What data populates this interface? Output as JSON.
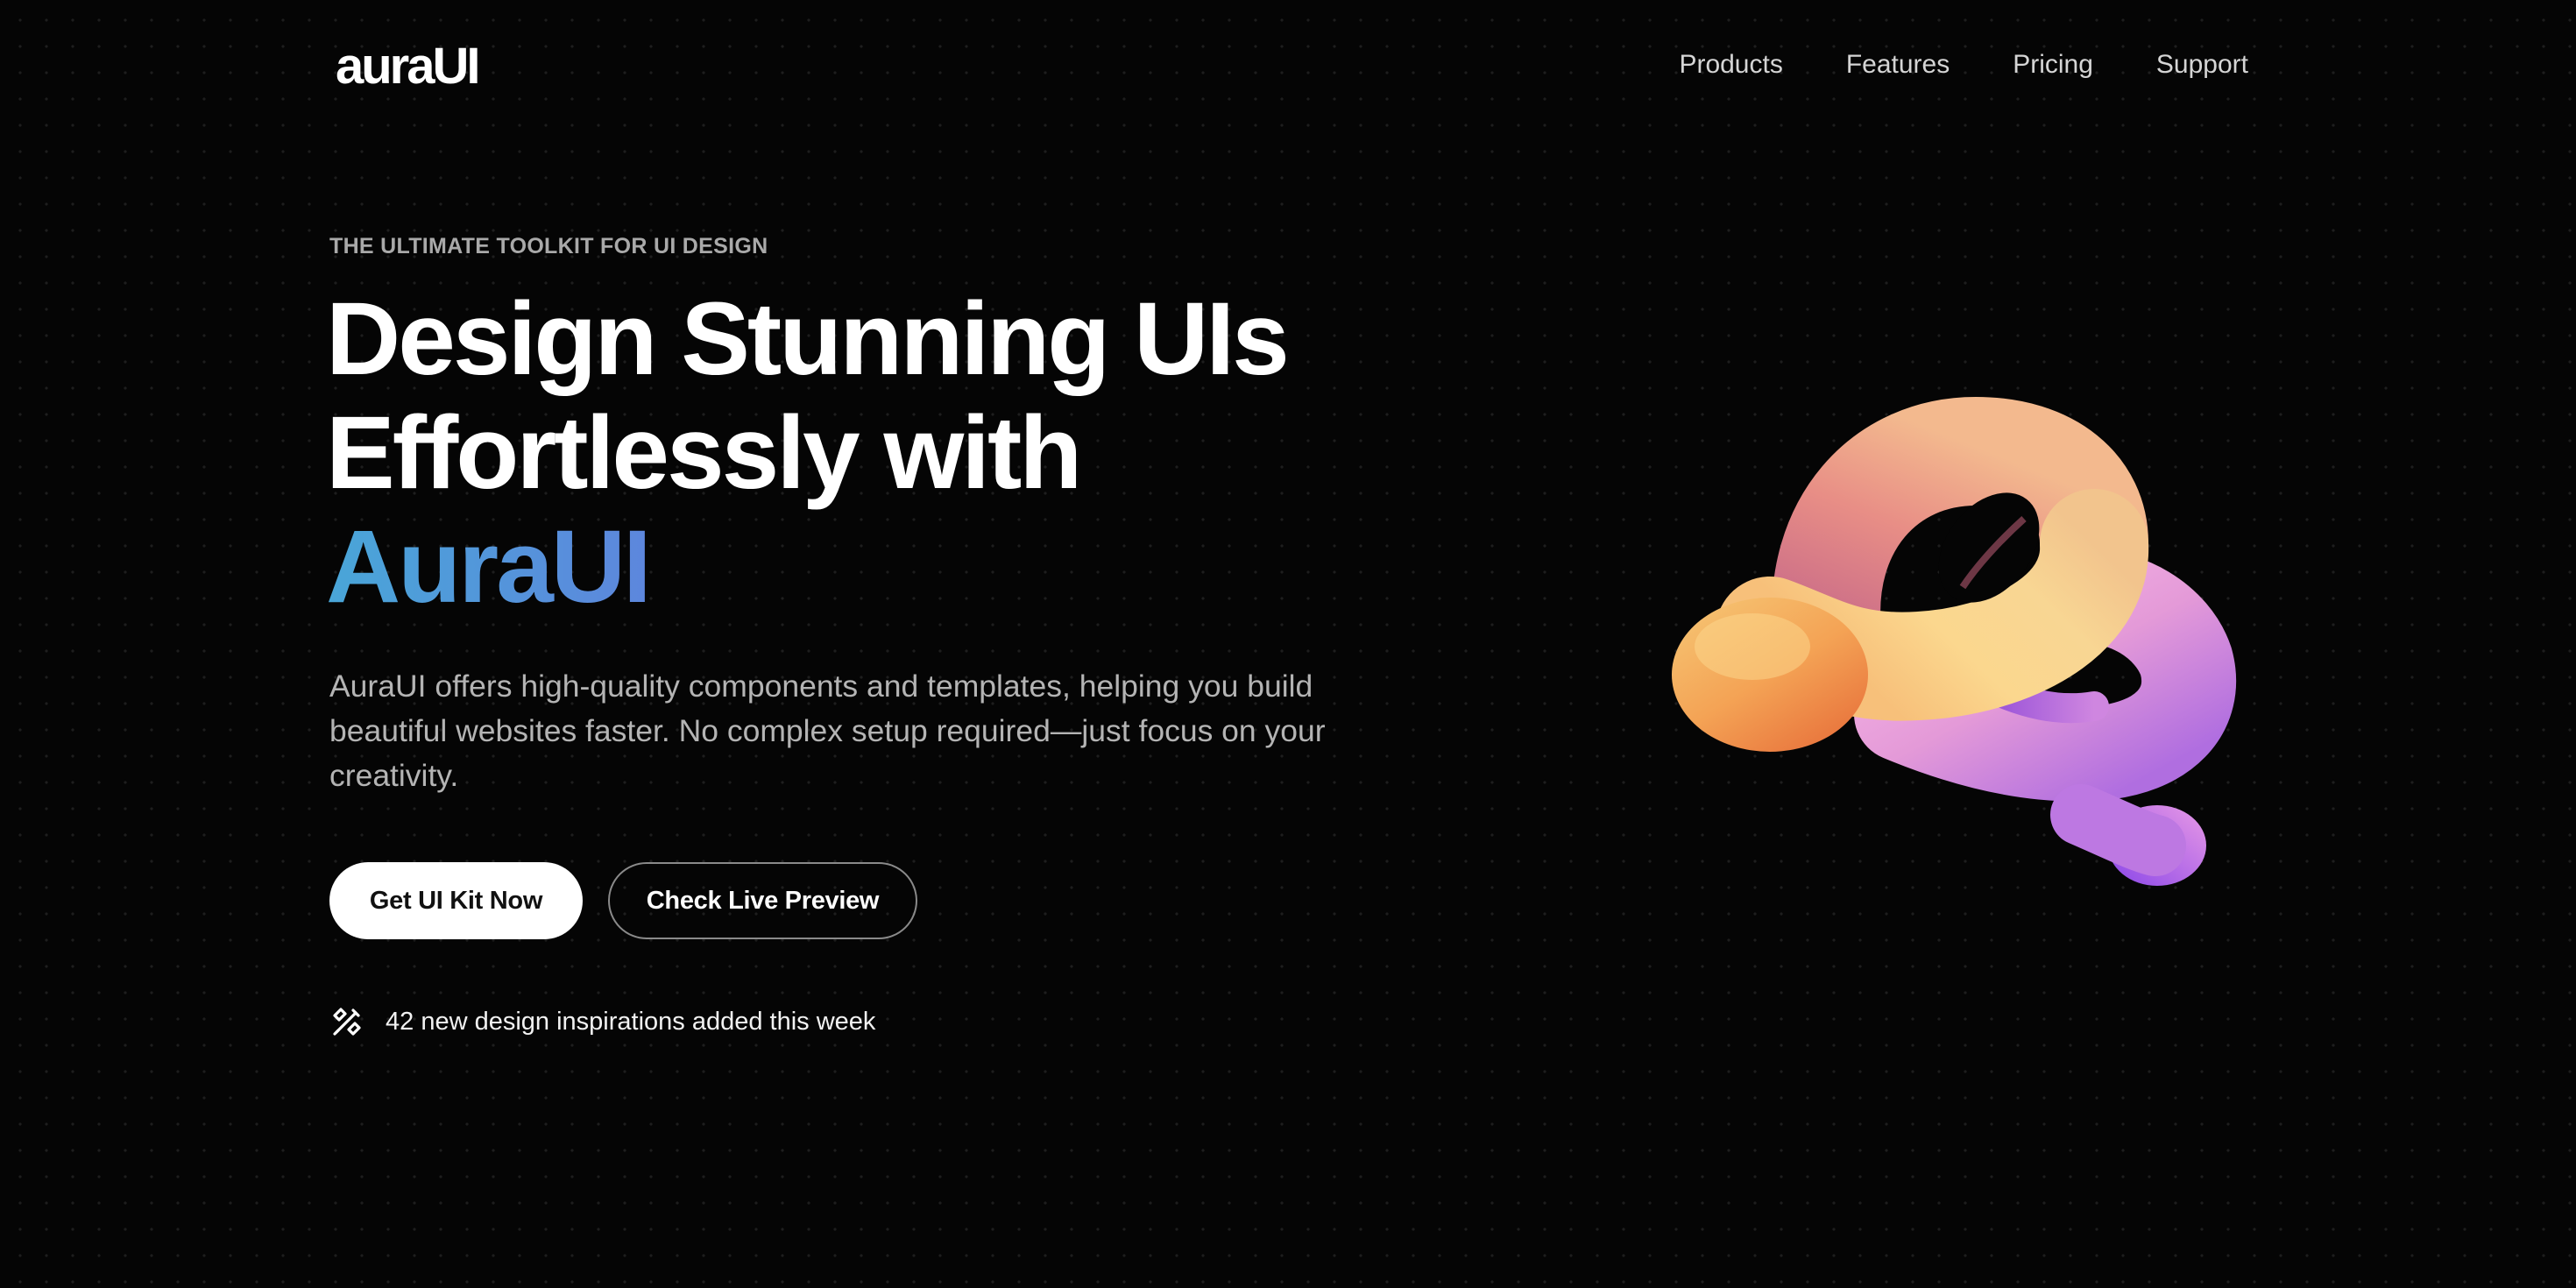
{
  "header": {
    "logo": "auraUI",
    "nav": [
      "Products",
      "Features",
      "Pricing",
      "Support"
    ]
  },
  "hero": {
    "eyebrow": "THE ULTIMATE TOOLKIT FOR UI DESIGN",
    "headline_line1": "Design Stunning UIs",
    "headline_line2": "Effortlessly with",
    "headline_brand": "AuraUI",
    "description": "AuraUI offers high-quality components and templates, helping you build beautiful websites faster. No complex setup required—just focus on your creativity.",
    "primary_button": "Get UI Kit Now",
    "secondary_button": "Check Live Preview",
    "note": "42 new design inspirations added this week",
    "note_icon": "design-tools-icon"
  },
  "colors": {
    "background": "#050505",
    "brand_gradient_start": "#49a6d8",
    "brand_gradient_end": "#8b4fe6",
    "button_primary_bg": "#ffffff"
  }
}
